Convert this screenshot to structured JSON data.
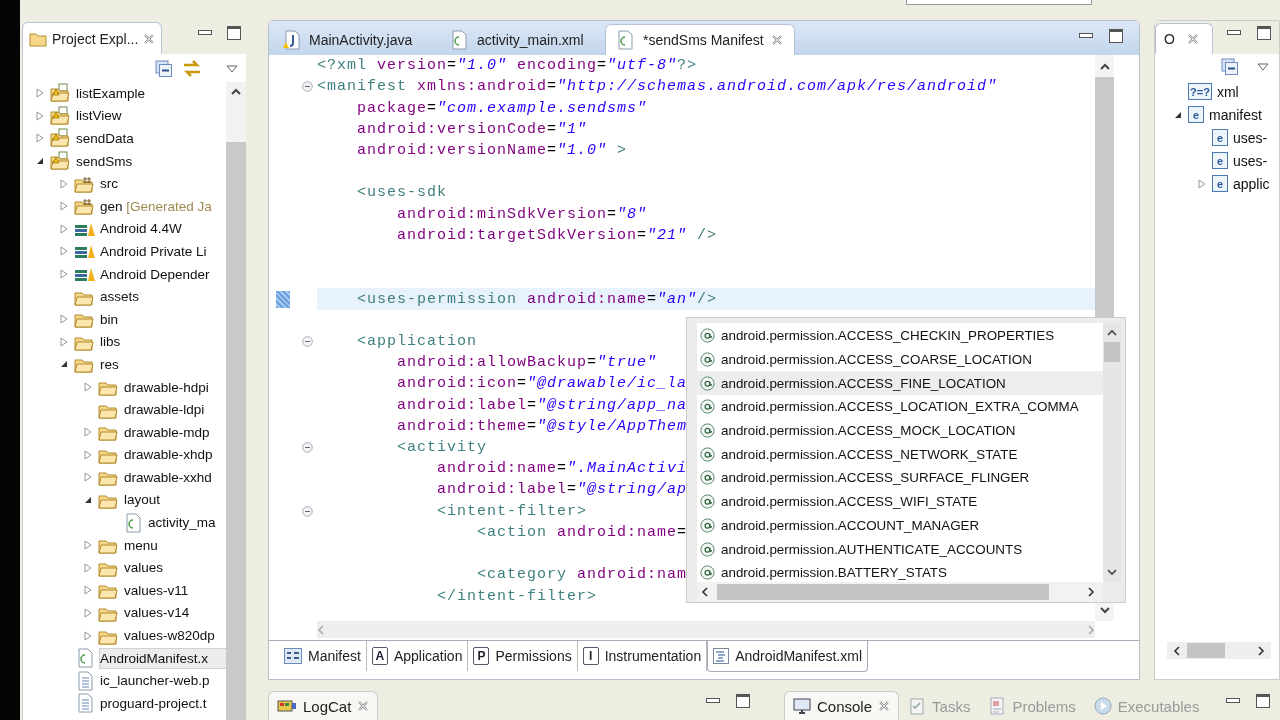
{
  "explorer": {
    "tab": {
      "label": "Project Expl...",
      "selected": true
    },
    "tree": [
      {
        "label": "listExample",
        "kind": "project",
        "expanded": false,
        "selected": false
      },
      {
        "label": "listView",
        "kind": "project",
        "expanded": false,
        "selected": false
      },
      {
        "label": "sendData",
        "kind": "project",
        "expanded": false,
        "selected": false
      },
      {
        "label": "sendSms",
        "kind": "project",
        "expanded": true,
        "selected": false,
        "children": [
          {
            "label": "src",
            "kind": "source",
            "expanded": false,
            "selected": false
          },
          {
            "label": "gen",
            "note": "[Generated Ja",
            "kind": "source",
            "expanded": false,
            "selected": false
          },
          {
            "label": "Android 4.4W",
            "kind": "library",
            "expanded": false,
            "selected": false
          },
          {
            "label": "Android Private Li",
            "kind": "library",
            "expanded": false,
            "selected": false
          },
          {
            "label": "Android Depender",
            "kind": "library",
            "expanded": false,
            "selected": false
          },
          {
            "label": "assets",
            "kind": "folder",
            "selected": false
          },
          {
            "label": "bin",
            "kind": "folder",
            "expanded": false,
            "selected": false
          },
          {
            "label": "libs",
            "kind": "folder",
            "expanded": false,
            "selected": false
          },
          {
            "label": "res",
            "kind": "folder",
            "expanded": true,
            "selected": false,
            "children": [
              {
                "label": "drawable-hdpi",
                "kind": "folder",
                "expanded": false,
                "selected": false
              },
              {
                "label": "drawable-ldpi",
                "kind": "folder",
                "selected": false
              },
              {
                "label": "drawable-mdp",
                "kind": "folder",
                "expanded": false,
                "selected": false
              },
              {
                "label": "drawable-xhdp",
                "kind": "folder",
                "expanded": false,
                "selected": false
              },
              {
                "label": "drawable-xxhd",
                "kind": "folder",
                "expanded": false,
                "selected": false
              },
              {
                "label": "layout",
                "kind": "folder",
                "expanded": true,
                "selected": false,
                "children": [
                  {
                    "label": "activity_ma",
                    "kind": "xml",
                    "selected": false
                  }
                ]
              },
              {
                "label": "menu",
                "kind": "folder",
                "expanded": false,
                "selected": false
              },
              {
                "label": "values",
                "kind": "folder",
                "expanded": false,
                "selected": false
              },
              {
                "label": "values-v11",
                "kind": "folder",
                "expanded": false,
                "selected": false
              },
              {
                "label": "values-v14",
                "kind": "folder",
                "expanded": false,
                "selected": false
              },
              {
                "label": "values-w820dp",
                "kind": "folder",
                "expanded": false,
                "selected": false
              }
            ]
          },
          {
            "label": "AndroidManifest.x",
            "kind": "xml",
            "selected": true
          },
          {
            "label": "ic_launcher-web.p",
            "kind": "text",
            "selected": false
          },
          {
            "label": "proguard-project.t",
            "kind": "text",
            "selected": false
          }
        ]
      }
    ]
  },
  "editor": {
    "tabs": [
      {
        "label": "MainActivity.java",
        "kind": "java",
        "selected": false
      },
      {
        "label": "activity_main.xml",
        "kind": "xml",
        "selected": false
      },
      {
        "label": "*sendSms Manifest",
        "kind": "xml",
        "selected": true
      }
    ],
    "code": [
      {
        "fold": false,
        "highlight": false,
        "tokens": [
          {
            "kind": "tag",
            "text": "<?xml"
          },
          {
            "kind": "attr",
            "text": " version"
          },
          {
            "kind": "plain",
            "text": "="
          },
          {
            "kind": "value",
            "text": "\"1.0\""
          },
          {
            "kind": "attr",
            "text": " encoding"
          },
          {
            "kind": "plain",
            "text": "="
          },
          {
            "kind": "value",
            "text": "\"utf-8\""
          },
          {
            "kind": "tag",
            "text": "?>"
          }
        ]
      },
      {
        "fold": true,
        "highlight": false,
        "tokens": [
          {
            "kind": "tag",
            "text": "<manifest"
          },
          {
            "kind": "attr",
            "text": " xmlns:android"
          },
          {
            "kind": "plain",
            "text": "="
          },
          {
            "kind": "value",
            "text": "\"http://schemas.android.com/apk/res/android\""
          }
        ]
      },
      {
        "fold": false,
        "highlight": false,
        "tokens": [
          {
            "kind": "attr",
            "text": "    package"
          },
          {
            "kind": "plain",
            "text": "="
          },
          {
            "kind": "value",
            "text": "\"com.example.sendsms\""
          }
        ]
      },
      {
        "fold": false,
        "highlight": false,
        "tokens": [
          {
            "kind": "attr",
            "text": "    android:versionCode"
          },
          {
            "kind": "plain",
            "text": "="
          },
          {
            "kind": "value",
            "text": "\"1\""
          }
        ]
      },
      {
        "fold": false,
        "highlight": false,
        "tokens": [
          {
            "kind": "attr",
            "text": "    android:versionName"
          },
          {
            "kind": "plain",
            "text": "="
          },
          {
            "kind": "value",
            "text": "\"1.0\""
          },
          {
            "kind": "tag",
            "text": " >"
          }
        ]
      },
      {
        "fold": false,
        "highlight": false
      },
      {
        "fold": false,
        "highlight": false,
        "tokens": [
          {
            "kind": "tag",
            "text": "    <uses-sdk"
          }
        ]
      },
      {
        "fold": false,
        "highlight": false,
        "tokens": [
          {
            "kind": "attr",
            "text": "        android:minSdkVersion"
          },
          {
            "kind": "plain",
            "text": "="
          },
          {
            "kind": "value",
            "text": "\"8\""
          }
        ]
      },
      {
        "fold": false,
        "highlight": false,
        "tokens": [
          {
            "kind": "attr",
            "text": "        android:targetSdkVersion"
          },
          {
            "kind": "plain",
            "text": "="
          },
          {
            "kind": "value",
            "text": "\"21\""
          },
          {
            "kind": "tag",
            "text": " />"
          }
        ]
      },
      {
        "fold": false,
        "highlight": false
      },
      {
        "fold": false,
        "highlight": false
      },
      {
        "fold": false,
        "highlight": true,
        "tokens": [
          {
            "kind": "tag",
            "text": "    <uses-permission"
          },
          {
            "kind": "attr",
            "text": " android:name"
          },
          {
            "kind": "plain",
            "text": "="
          },
          {
            "kind": "value",
            "text": "\"an\""
          },
          {
            "kind": "tag",
            "text": "/>"
          }
        ]
      },
      {
        "fold": false,
        "highlight": false
      },
      {
        "fold": true,
        "highlight": false,
        "tokens": [
          {
            "kind": "tag",
            "text": "    <application"
          }
        ]
      },
      {
        "fold": false,
        "highlight": false,
        "tokens": [
          {
            "kind": "attr",
            "text": "        android:allowBackup"
          },
          {
            "kind": "plain",
            "text": "="
          },
          {
            "kind": "value",
            "text": "\"true\""
          }
        ]
      },
      {
        "fold": false,
        "highlight": false,
        "tokens": [
          {
            "kind": "attr",
            "text": "        android:icon"
          },
          {
            "kind": "plain",
            "text": "="
          },
          {
            "kind": "value",
            "text": "\"@drawable/ic_la"
          }
        ]
      },
      {
        "fold": false,
        "highlight": false,
        "tokens": [
          {
            "kind": "attr",
            "text": "        android:label"
          },
          {
            "kind": "plain",
            "text": "="
          },
          {
            "kind": "value",
            "text": "\"@string/app_na"
          }
        ]
      },
      {
        "fold": false,
        "highlight": false,
        "tokens": [
          {
            "kind": "attr",
            "text": "        android:theme"
          },
          {
            "kind": "plain",
            "text": "="
          },
          {
            "kind": "value",
            "text": "\"@style/AppThem"
          }
        ]
      },
      {
        "fold": true,
        "highlight": false,
        "tokens": [
          {
            "kind": "tag",
            "text": "        <activity"
          }
        ]
      },
      {
        "fold": false,
        "highlight": false,
        "tokens": [
          {
            "kind": "attr",
            "text": "            android:name"
          },
          {
            "kind": "plain",
            "text": "="
          },
          {
            "kind": "value",
            "text": "\".MainActivi"
          }
        ]
      },
      {
        "fold": false,
        "highlight": false,
        "tokens": [
          {
            "kind": "attr",
            "text": "            android:label"
          },
          {
            "kind": "plain",
            "text": "="
          },
          {
            "kind": "value",
            "text": "\"@string/ap"
          }
        ]
      },
      {
        "fold": true,
        "highlight": false,
        "tokens": [
          {
            "kind": "tag",
            "text": "            <intent-filter>"
          }
        ]
      },
      {
        "fold": false,
        "highlight": false,
        "tokens": [
          {
            "kind": "tag",
            "text": "                <action"
          },
          {
            "kind": "attr",
            "text": " android:name"
          },
          {
            "kind": "plain",
            "text": "="
          }
        ]
      },
      {
        "fold": false,
        "highlight": false
      },
      {
        "fold": false,
        "highlight": false,
        "tokens": [
          {
            "kind": "tag",
            "text": "                <category"
          },
          {
            "kind": "attr",
            "text": " android:nam"
          }
        ]
      },
      {
        "fold": false,
        "highlight": false,
        "tokens": [
          {
            "kind": "tag",
            "text": "            </intent-filter>"
          }
        ]
      }
    ],
    "completion": {
      "items": [
        {
          "label": "android.permission.ACCESS_CHECKIN_PROPERTIES",
          "selected": false
        },
        {
          "label": "android.permission.ACCESS_COARSE_LOCATION",
          "selected": false
        },
        {
          "label": "android.permission.ACCESS_FINE_LOCATION",
          "selected": true
        },
        {
          "label": "android.permission.ACCESS_LOCATION_EXTRA_COMMA",
          "selected": false
        },
        {
          "label": "android.permission.ACCESS_MOCK_LOCATION",
          "selected": false
        },
        {
          "label": "android.permission.ACCESS_NETWORK_STATE",
          "selected": false
        },
        {
          "label": "android.permission.ACCESS_SURFACE_FLINGER",
          "selected": false
        },
        {
          "label": "android.permission.ACCESS_WIFI_STATE",
          "selected": false
        },
        {
          "label": "android.permission.ACCOUNT_MANAGER",
          "selected": false
        },
        {
          "label": "android.permission.AUTHENTICATE_ACCOUNTS",
          "selected": false
        },
        {
          "label": "android.permission.BATTERY_STATS",
          "selected": false
        }
      ]
    },
    "pages": [
      {
        "label": "Manifest",
        "kind": "form",
        "selected": false
      },
      {
        "label": "Application",
        "kind": "letter",
        "badge": "A",
        "selected": false
      },
      {
        "label": "Permissions",
        "kind": "letter",
        "badge": "P",
        "selected": false
      },
      {
        "label": "Instrumentation",
        "kind": "letter",
        "badge": "I",
        "selected": false
      },
      {
        "label": "AndroidManifest.xml",
        "kind": "source",
        "selected": true
      }
    ]
  },
  "outline": {
    "tab": {
      "label": "O",
      "selected": true
    },
    "tree": [
      {
        "label": "xml",
        "badge": "?=?"
      },
      {
        "label": "manifest",
        "badge": "e",
        "expanded": true,
        "children": [
          {
            "label": "uses-",
            "badge": "e"
          },
          {
            "label": "uses-",
            "badge": "e"
          },
          {
            "label": "applic",
            "badge": "e",
            "expanded": false
          }
        ]
      }
    ]
  },
  "docks": [
    {
      "tabs": [
        {
          "label": "LogCat",
          "kind": "logcat",
          "selected": true
        }
      ]
    },
    {
      "tabs": [
        {
          "label": "Console",
          "kind": "console",
          "selected": true
        },
        {
          "label": "Tasks",
          "kind": "tasks",
          "selected": false
        },
        {
          "label": "Problems",
          "kind": "problems",
          "selected": false
        },
        {
          "label": "Executables",
          "kind": "executables",
          "selected": false
        }
      ]
    }
  ]
}
